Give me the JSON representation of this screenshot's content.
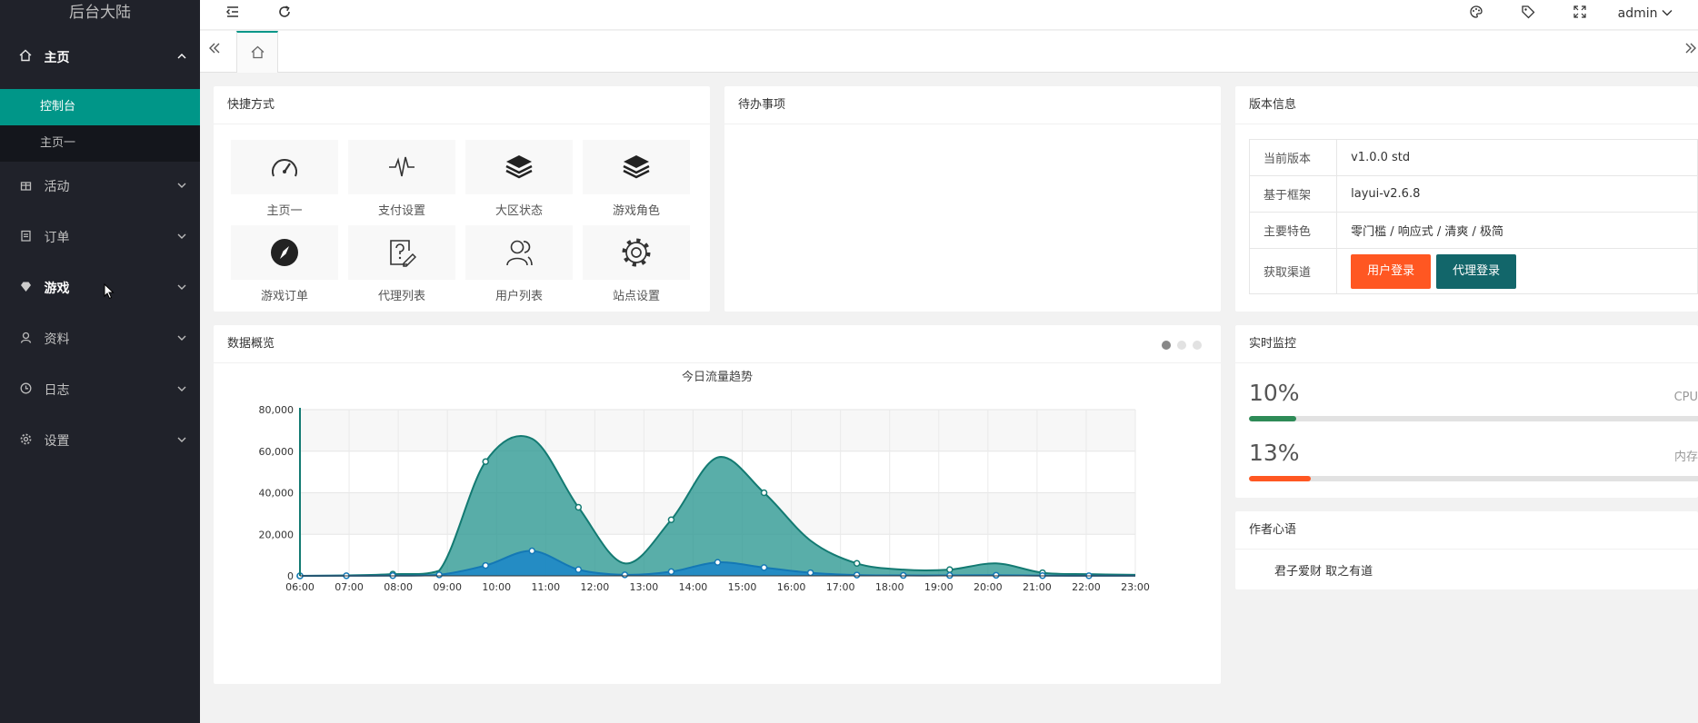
{
  "app": {
    "title": "后台大陆"
  },
  "colors": {
    "teal": "#009688",
    "darkTeal": "#12666a",
    "orange": "#ff5722",
    "green": "#2e8b57",
    "sidebar": "#20222a"
  },
  "sidebar": {
    "items": [
      {
        "label": "主页",
        "icon": "home-icon"
      },
      {
        "label": "活动",
        "icon": "gift-icon"
      },
      {
        "label": "订单",
        "icon": "clipboard-icon"
      },
      {
        "label": "游戏",
        "icon": "diamond-icon"
      },
      {
        "label": "资料",
        "icon": "user-icon"
      },
      {
        "label": "日志",
        "icon": "clock-icon"
      },
      {
        "label": "设置",
        "icon": "settings-icon"
      }
    ],
    "subitems": [
      {
        "label": "控制台"
      },
      {
        "label": "主页一"
      }
    ]
  },
  "header": {
    "admin": "admin"
  },
  "quick": {
    "title": "快捷方式",
    "items": [
      {
        "label": "主页一",
        "icon": "dashboard-gauge-icon"
      },
      {
        "label": "支付设置",
        "icon": "pulse-icon"
      },
      {
        "label": "大区状态",
        "icon": "layers-icon"
      },
      {
        "label": "游戏角色",
        "icon": "layers-icon"
      },
      {
        "label": "游戏订单",
        "icon": "compass-icon"
      },
      {
        "label": "代理列表",
        "icon": "help-edit-icon"
      },
      {
        "label": "用户列表",
        "icon": "users-icon"
      },
      {
        "label": "站点设置",
        "icon": "gear-icon"
      }
    ]
  },
  "todo": {
    "title": "待办事项"
  },
  "version": {
    "title": "版本信息",
    "rows": [
      {
        "key": "当前版本",
        "value": "v1.0.0 std"
      },
      {
        "key": "基于框架",
        "value": "layui-v2.6.8"
      },
      {
        "key": "主要特色",
        "value": "零门槛 / 响应式 / 清爽 / 极简"
      }
    ],
    "channel_key": "获取渠道",
    "btn_user": "用户登录",
    "btn_agent": "代理登录"
  },
  "overview": {
    "title": "数据概览"
  },
  "monitor": {
    "title": "实时监控",
    "cpu_value": "10%",
    "cpu_label": "CPU使用",
    "cpu_pct": 10,
    "mem_value": "13%",
    "mem_label": "内存占用",
    "mem_pct": 13
  },
  "author": {
    "title": "作者心语",
    "quote": "君子爱财 取之有道"
  },
  "chart_data": {
    "type": "area",
    "title": "今日流量趋势",
    "x": [
      "06:00",
      "07:00",
      "08:00",
      "09:00",
      "10:00",
      "11:00",
      "12:00",
      "13:00",
      "14:00",
      "15:00",
      "16:00",
      "17:00",
      "18:00",
      "19:00",
      "20:00",
      "21:00",
      "22:00",
      "23:00"
    ],
    "ylim": [
      0,
      80000
    ],
    "yticks": [
      "0",
      "20,000",
      "40,000",
      "60,000",
      "80,000"
    ],
    "series": [
      {
        "name": "",
        "color": "#2f9a94",
        "values": [
          0,
          200,
          800,
          2500,
          55000,
          66000,
          33000,
          6000,
          27000,
          57000,
          40000,
          17000,
          6000,
          3000,
          3000,
          6000,
          1500,
          800,
          500
        ]
      },
      {
        "name": "",
        "color": "#1e88c7",
        "values": [
          0,
          50,
          100,
          500,
          5000,
          12000,
          3000,
          500,
          2000,
          6500,
          4000,
          1500,
          400,
          200,
          200,
          300,
          100,
          50,
          30
        ]
      }
    ]
  }
}
